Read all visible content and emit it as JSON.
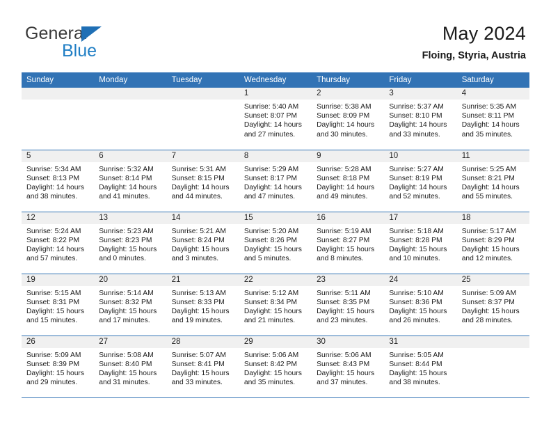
{
  "logo": {
    "word_one": "General",
    "word_two": "Blue",
    "triangle_icon": "blue-triangle-icon",
    "accent_dark": "#3a3a3a",
    "accent_blue": "#1f7ec4"
  },
  "header": {
    "title": "May 2024",
    "subtitle": "Floing, Styria, Austria"
  },
  "colors": {
    "header_blue": "#3273b5",
    "daynum_band": "#f0f0f0",
    "grid_line": "#3273b5",
    "text": "#1a1a1a"
  },
  "weekday_headers": [
    "Sunday",
    "Monday",
    "Tuesday",
    "Wednesday",
    "Thursday",
    "Friday",
    "Saturday"
  ],
  "weeks": [
    [
      {
        "day": "",
        "sunrise": "",
        "sunset": "",
        "daylight_line1": "",
        "daylight_line2": ""
      },
      {
        "day": "",
        "sunrise": "",
        "sunset": "",
        "daylight_line1": "",
        "daylight_line2": ""
      },
      {
        "day": "",
        "sunrise": "",
        "sunset": "",
        "daylight_line1": "",
        "daylight_line2": ""
      },
      {
        "day": "1",
        "sunrise": "Sunrise: 5:40 AM",
        "sunset": "Sunset: 8:07 PM",
        "daylight_line1": "Daylight: 14 hours",
        "daylight_line2": "and 27 minutes."
      },
      {
        "day": "2",
        "sunrise": "Sunrise: 5:38 AM",
        "sunset": "Sunset: 8:09 PM",
        "daylight_line1": "Daylight: 14 hours",
        "daylight_line2": "and 30 minutes."
      },
      {
        "day": "3",
        "sunrise": "Sunrise: 5:37 AM",
        "sunset": "Sunset: 8:10 PM",
        "daylight_line1": "Daylight: 14 hours",
        "daylight_line2": "and 33 minutes."
      },
      {
        "day": "4",
        "sunrise": "Sunrise: 5:35 AM",
        "sunset": "Sunset: 8:11 PM",
        "daylight_line1": "Daylight: 14 hours",
        "daylight_line2": "and 35 minutes."
      }
    ],
    [
      {
        "day": "5",
        "sunrise": "Sunrise: 5:34 AM",
        "sunset": "Sunset: 8:13 PM",
        "daylight_line1": "Daylight: 14 hours",
        "daylight_line2": "and 38 minutes."
      },
      {
        "day": "6",
        "sunrise": "Sunrise: 5:32 AM",
        "sunset": "Sunset: 8:14 PM",
        "daylight_line1": "Daylight: 14 hours",
        "daylight_line2": "and 41 minutes."
      },
      {
        "day": "7",
        "sunrise": "Sunrise: 5:31 AM",
        "sunset": "Sunset: 8:15 PM",
        "daylight_line1": "Daylight: 14 hours",
        "daylight_line2": "and 44 minutes."
      },
      {
        "day": "8",
        "sunrise": "Sunrise: 5:29 AM",
        "sunset": "Sunset: 8:17 PM",
        "daylight_line1": "Daylight: 14 hours",
        "daylight_line2": "and 47 minutes."
      },
      {
        "day": "9",
        "sunrise": "Sunrise: 5:28 AM",
        "sunset": "Sunset: 8:18 PM",
        "daylight_line1": "Daylight: 14 hours",
        "daylight_line2": "and 49 minutes."
      },
      {
        "day": "10",
        "sunrise": "Sunrise: 5:27 AM",
        "sunset": "Sunset: 8:19 PM",
        "daylight_line1": "Daylight: 14 hours",
        "daylight_line2": "and 52 minutes."
      },
      {
        "day": "11",
        "sunrise": "Sunrise: 5:25 AM",
        "sunset": "Sunset: 8:21 PM",
        "daylight_line1": "Daylight: 14 hours",
        "daylight_line2": "and 55 minutes."
      }
    ],
    [
      {
        "day": "12",
        "sunrise": "Sunrise: 5:24 AM",
        "sunset": "Sunset: 8:22 PM",
        "daylight_line1": "Daylight: 14 hours",
        "daylight_line2": "and 57 minutes."
      },
      {
        "day": "13",
        "sunrise": "Sunrise: 5:23 AM",
        "sunset": "Sunset: 8:23 PM",
        "daylight_line1": "Daylight: 15 hours",
        "daylight_line2": "and 0 minutes."
      },
      {
        "day": "14",
        "sunrise": "Sunrise: 5:21 AM",
        "sunset": "Sunset: 8:24 PM",
        "daylight_line1": "Daylight: 15 hours",
        "daylight_line2": "and 3 minutes."
      },
      {
        "day": "15",
        "sunrise": "Sunrise: 5:20 AM",
        "sunset": "Sunset: 8:26 PM",
        "daylight_line1": "Daylight: 15 hours",
        "daylight_line2": "and 5 minutes."
      },
      {
        "day": "16",
        "sunrise": "Sunrise: 5:19 AM",
        "sunset": "Sunset: 8:27 PM",
        "daylight_line1": "Daylight: 15 hours",
        "daylight_line2": "and 8 minutes."
      },
      {
        "day": "17",
        "sunrise": "Sunrise: 5:18 AM",
        "sunset": "Sunset: 8:28 PM",
        "daylight_line1": "Daylight: 15 hours",
        "daylight_line2": "and 10 minutes."
      },
      {
        "day": "18",
        "sunrise": "Sunrise: 5:17 AM",
        "sunset": "Sunset: 8:29 PM",
        "daylight_line1": "Daylight: 15 hours",
        "daylight_line2": "and 12 minutes."
      }
    ],
    [
      {
        "day": "19",
        "sunrise": "Sunrise: 5:15 AM",
        "sunset": "Sunset: 8:31 PM",
        "daylight_line1": "Daylight: 15 hours",
        "daylight_line2": "and 15 minutes."
      },
      {
        "day": "20",
        "sunrise": "Sunrise: 5:14 AM",
        "sunset": "Sunset: 8:32 PM",
        "daylight_line1": "Daylight: 15 hours",
        "daylight_line2": "and 17 minutes."
      },
      {
        "day": "21",
        "sunrise": "Sunrise: 5:13 AM",
        "sunset": "Sunset: 8:33 PM",
        "daylight_line1": "Daylight: 15 hours",
        "daylight_line2": "and 19 minutes."
      },
      {
        "day": "22",
        "sunrise": "Sunrise: 5:12 AM",
        "sunset": "Sunset: 8:34 PM",
        "daylight_line1": "Daylight: 15 hours",
        "daylight_line2": "and 21 minutes."
      },
      {
        "day": "23",
        "sunrise": "Sunrise: 5:11 AM",
        "sunset": "Sunset: 8:35 PM",
        "daylight_line1": "Daylight: 15 hours",
        "daylight_line2": "and 23 minutes."
      },
      {
        "day": "24",
        "sunrise": "Sunrise: 5:10 AM",
        "sunset": "Sunset: 8:36 PM",
        "daylight_line1": "Daylight: 15 hours",
        "daylight_line2": "and 26 minutes."
      },
      {
        "day": "25",
        "sunrise": "Sunrise: 5:09 AM",
        "sunset": "Sunset: 8:37 PM",
        "daylight_line1": "Daylight: 15 hours",
        "daylight_line2": "and 28 minutes."
      }
    ],
    [
      {
        "day": "26",
        "sunrise": "Sunrise: 5:09 AM",
        "sunset": "Sunset: 8:39 PM",
        "daylight_line1": "Daylight: 15 hours",
        "daylight_line2": "and 29 minutes."
      },
      {
        "day": "27",
        "sunrise": "Sunrise: 5:08 AM",
        "sunset": "Sunset: 8:40 PM",
        "daylight_line1": "Daylight: 15 hours",
        "daylight_line2": "and 31 minutes."
      },
      {
        "day": "28",
        "sunrise": "Sunrise: 5:07 AM",
        "sunset": "Sunset: 8:41 PM",
        "daylight_line1": "Daylight: 15 hours",
        "daylight_line2": "and 33 minutes."
      },
      {
        "day": "29",
        "sunrise": "Sunrise: 5:06 AM",
        "sunset": "Sunset: 8:42 PM",
        "daylight_line1": "Daylight: 15 hours",
        "daylight_line2": "and 35 minutes."
      },
      {
        "day": "30",
        "sunrise": "Sunrise: 5:06 AM",
        "sunset": "Sunset: 8:43 PM",
        "daylight_line1": "Daylight: 15 hours",
        "daylight_line2": "and 37 minutes."
      },
      {
        "day": "31",
        "sunrise": "Sunrise: 5:05 AM",
        "sunset": "Sunset: 8:44 PM",
        "daylight_line1": "Daylight: 15 hours",
        "daylight_line2": "and 38 minutes."
      },
      {
        "day": "",
        "sunrise": "",
        "sunset": "",
        "daylight_line1": "",
        "daylight_line2": ""
      }
    ]
  ]
}
